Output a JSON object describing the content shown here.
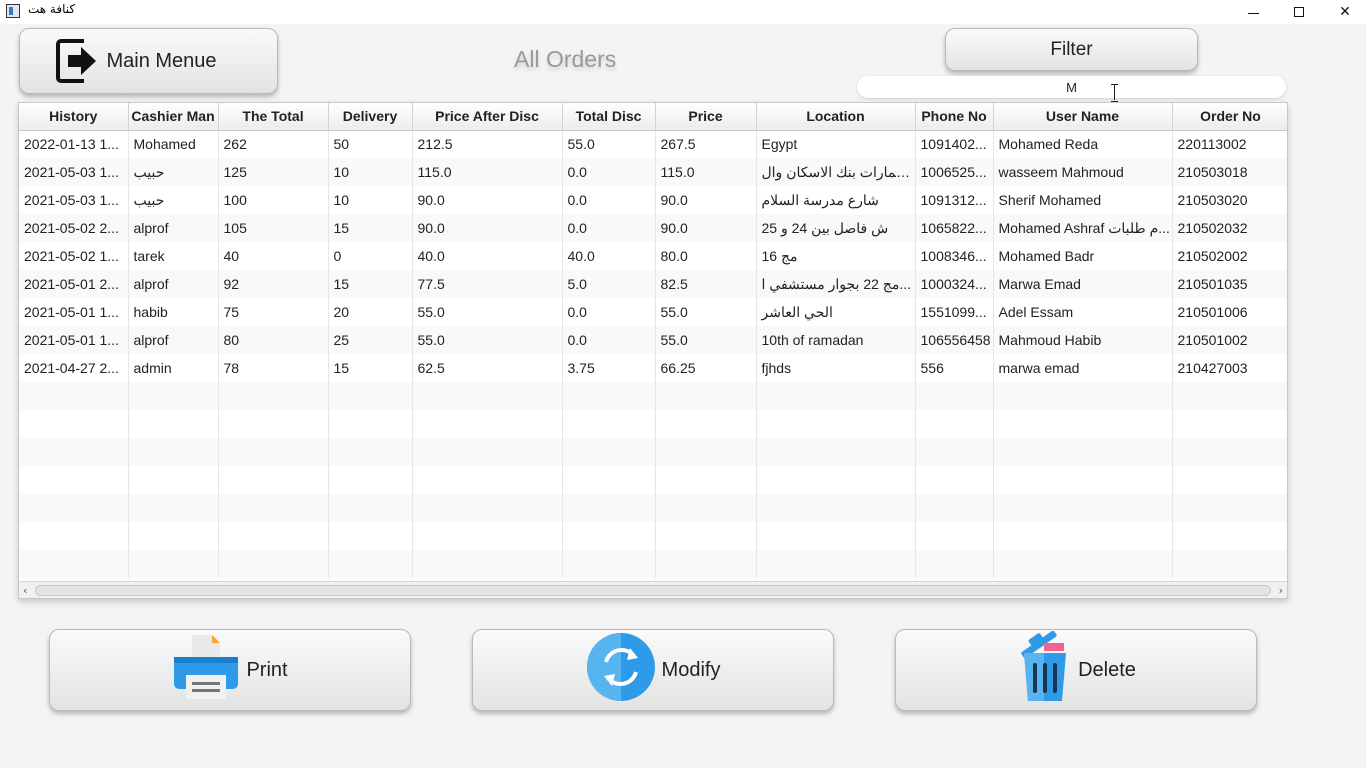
{
  "window": {
    "title": "كنافة هت"
  },
  "main_menu": {
    "label": "Main Menue"
  },
  "page_title": "All Orders",
  "filter": {
    "button_label": "Filter",
    "input_value": "M"
  },
  "table": {
    "columns": [
      "History",
      "Cashier Man",
      "The Total",
      "Delivery",
      "Price After Disc",
      "Total Disc",
      "Price",
      "Location",
      "Phone No",
      "User Name",
      "Order No"
    ],
    "rows": [
      [
        "2022-01-13 1...",
        "Mohamed",
        "262",
        "50",
        "212.5",
        "55.0",
        "267.5",
        "Egypt",
        "1091402...",
        "Mohamed Reda",
        "220113002"
      ],
      [
        "2021-05-03 1...",
        "حبيب",
        "125",
        "10",
        "115.0",
        "0.0",
        "115.0",
        "عمارات بنك الاسكان وال...",
        "1006525...",
        "wasseem Mahmoud",
        "210503018"
      ],
      [
        "2021-05-03 1...",
        "حبيب",
        "100",
        "10",
        "90.0",
        "0.0",
        "90.0",
        "شارع مدرسة السلام",
        "1091312...",
        "Sherif Mohamed",
        "210503020"
      ],
      [
        "2021-05-02 2...",
        "alprof",
        "105",
        "15",
        "90.0",
        "0.0",
        "90.0",
        "ش فاصل بين 24 و 25",
        "1065822...",
        "Mohamed Ashraf م طلبات...",
        "210502032"
      ],
      [
        "2021-05-02 1...",
        "tarek",
        "40",
        "0",
        "40.0",
        "40.0",
        "80.0",
        "مج 16",
        "1008346...",
        "Mohamed Badr",
        "210502002"
      ],
      [
        "2021-05-01 2...",
        "alprof",
        "92",
        "15",
        "77.5",
        "5.0",
        "82.5",
        "مج 22 بجوار مستشفي ا...",
        "1000324...",
        "Marwa Emad",
        "210501035"
      ],
      [
        "2021-05-01 1...",
        "habib",
        "75",
        "20",
        "55.0",
        "0.0",
        "55.0",
        "الحي العاشر",
        "1551099...",
        "Adel Essam",
        "210501006"
      ],
      [
        "2021-05-01 1...",
        "alprof",
        "80",
        "25",
        "55.0",
        "0.0",
        "55.0",
        "10th of ramadan",
        "106556458",
        "Mahmoud Habib",
        "210501002"
      ],
      [
        "2021-04-27 2...",
        "admin",
        "78",
        "15",
        "62.5",
        "3.75",
        "66.25",
        "fjhds",
        "556",
        "marwa emad",
        "210427003"
      ]
    ]
  },
  "actions": {
    "print_label": "Print",
    "modify_label": "Modify",
    "delete_label": "Delete"
  },
  "colors": {
    "accent_blue": "#2f9be8",
    "printer_orange": "#f5a623",
    "trash_pink": "#f06292"
  }
}
